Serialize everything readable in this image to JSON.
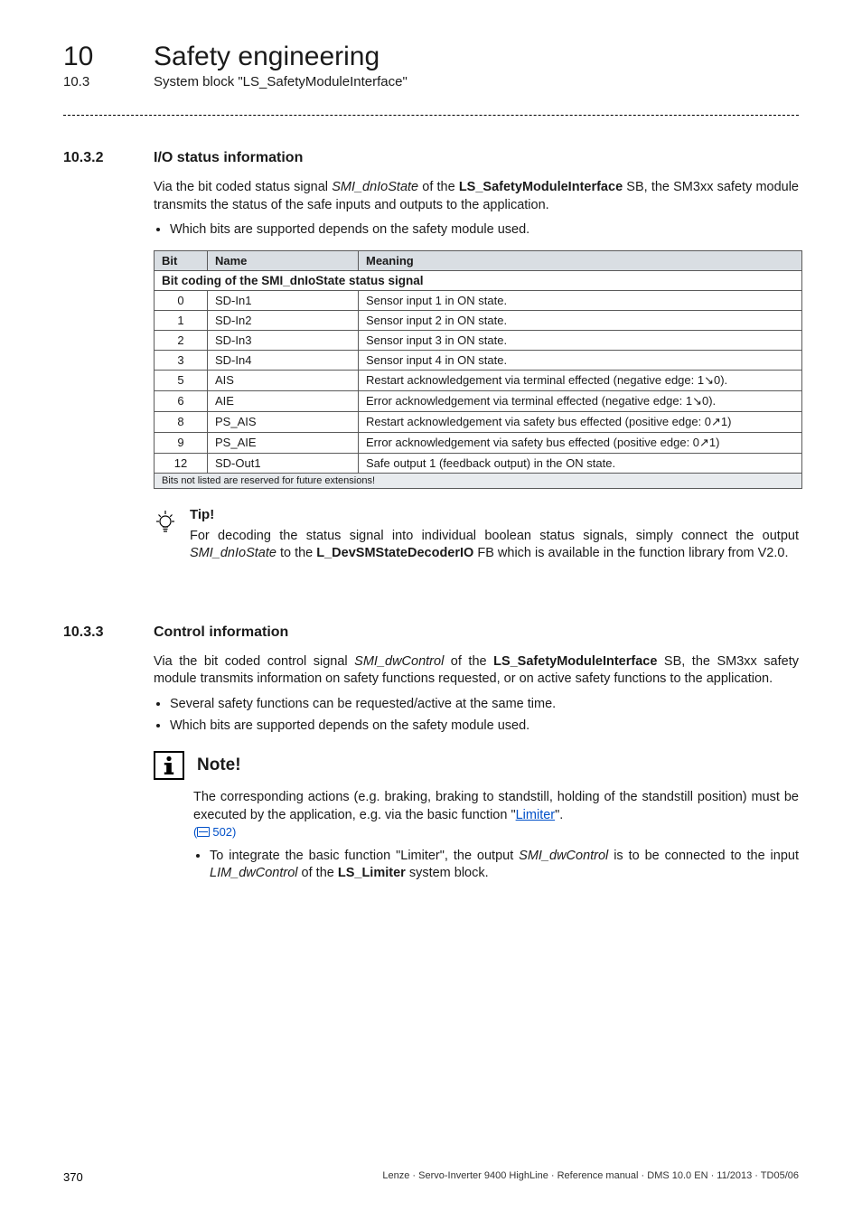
{
  "header": {
    "chapter_num": "10",
    "chapter_title": "Safety engineering",
    "section_num": "10.3",
    "section_title": "System block \"LS_SafetyModuleInterface\""
  },
  "sec_1032": {
    "num": "10.3.2",
    "title": "I/O status information",
    "para_pre": "Via the bit coded status signal ",
    "para_signal": "SMI_dnIoState",
    "para_mid": " of the ",
    "para_sb": "LS_SafetyModuleInterface",
    "para_post": " SB, the SM3xx safety module transmits the status of the safe inputs and outputs to the application.",
    "bullet1": "Which bits are supported depends on the safety module used."
  },
  "table": {
    "title": "Bit coding of the SMI_dnIoState status signal",
    "col_bit": "Bit",
    "col_name": "Name",
    "col_meaning": "Meaning",
    "rows": [
      {
        "bit": "0",
        "name": "SD-In1",
        "meaning": "Sensor input 1 in ON state."
      },
      {
        "bit": "1",
        "name": "SD-In2",
        "meaning": "Sensor input 2 in ON state."
      },
      {
        "bit": "2",
        "name": "SD-In3",
        "meaning": "Sensor input 3 in ON state."
      },
      {
        "bit": "3",
        "name": "SD-In4",
        "meaning": "Sensor input 4 in ON state."
      },
      {
        "bit": "5",
        "name": "AIS",
        "meaning": "Restart acknowledgement via terminal effected (negative edge: 1↘0)."
      },
      {
        "bit": "6",
        "name": "AIE",
        "meaning": "Error acknowledgement via terminal effected (negative edge: 1↘0)."
      },
      {
        "bit": "8",
        "name": "PS_AIS",
        "meaning": "Restart acknowledgement via safety bus effected (positive edge: 0↗1)"
      },
      {
        "bit": "9",
        "name": "PS_AIE",
        "meaning": "Error acknowledgement via safety bus effected (positive edge: 0↗1)"
      },
      {
        "bit": "12",
        "name": "SD-Out1",
        "meaning": "Safe output 1 (feedback output) in the ON state."
      }
    ],
    "footnote": "Bits not listed are reserved for future extensions!"
  },
  "tip": {
    "title": "Tip!",
    "text_pre": "For decoding the status signal into individual boolean status signals, simply connect the output ",
    "text_sig": "SMI_dnIoState",
    "text_mid": " to the ",
    "text_fb": "L_DevSMStateDecoderIO",
    "text_post": " FB which is available in the function library from V2.0."
  },
  "sec_1033": {
    "num": "10.3.3",
    "title": "Control information",
    "para_pre": "Via the bit coded control signal ",
    "para_signal": "SMI_dwControl",
    "para_mid": " of the ",
    "para_sb": "LS_SafetyModuleInterface",
    "para_post": " SB, the SM3xx safety module transmits information on safety functions requested, or on active safety functions to the application.",
    "bullet1": "Several safety functions can be requested/active at the same time.",
    "bullet2": "Which bits are supported depends on the safety module used."
  },
  "note": {
    "title": "Note!",
    "body_pre": "The corresponding actions (e.g. braking, braking to standstill, holding of the standstill position) must be executed by the application, e.g. via the basic function \"",
    "body_link": "Limiter",
    "body_post": "\".",
    "pageref": "502",
    "bullet_pre": "To integrate the basic function \"Limiter\", the output ",
    "bullet_sig1": "SMI_dwControl",
    "bullet_mid": " is to be connected to the input ",
    "bullet_sig2": "LIM_dwControl",
    "bullet_mid2": " of the ",
    "bullet_sb": "LS_Limiter",
    "bullet_post": " system block."
  },
  "footer": {
    "page": "370",
    "line": "Lenze · Servo-Inverter 9400 HighLine · Reference manual · DMS 10.0 EN · 11/2013 · TD05/06"
  }
}
